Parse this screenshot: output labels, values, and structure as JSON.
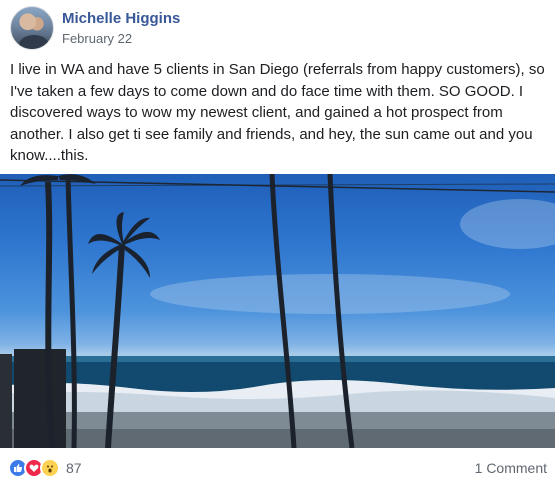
{
  "post": {
    "author": "Michelle Higgins",
    "date": "February 22",
    "message": "I live in WA and have 5 clients in San Diego (referrals from happy customers), so I've taken a few days to come down and do face time with them. SO GOOD. I discovered ways to wow my newest client, and gained a hot prospect from another. I also get ti see family and friends, and hey, the sun came out and you know....this.",
    "avatar_icon": "profile-photo",
    "photo_icon": "beach-palm-trees-photo"
  },
  "reactions": {
    "icons": [
      "like-icon",
      "love-icon",
      "wow-icon"
    ],
    "count": "87",
    "colors": {
      "like": "#3b7bea",
      "love": "#f0284a",
      "wow": "#fdd151"
    }
  },
  "comments": {
    "label": "1 Comment"
  },
  "theme": {
    "author_color": "#385898",
    "meta_color": "#606770"
  }
}
